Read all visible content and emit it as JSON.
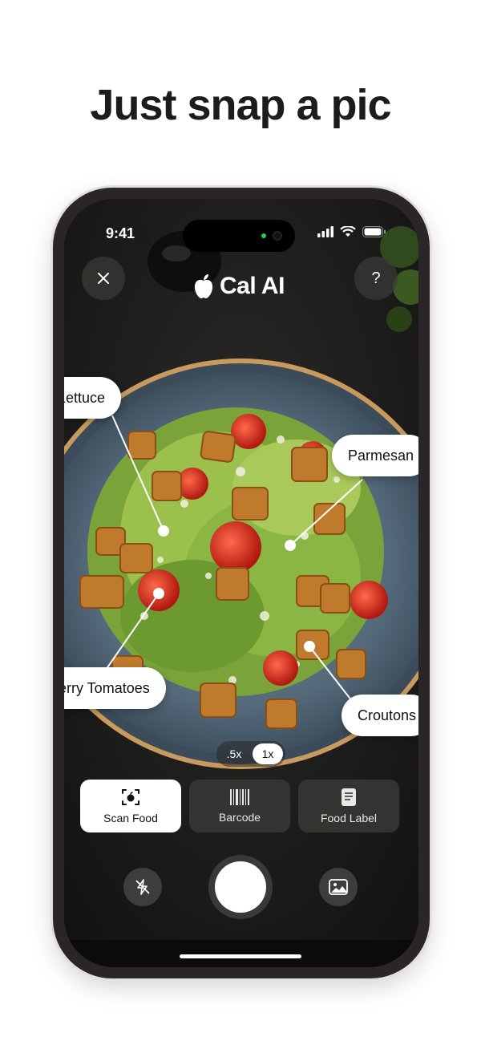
{
  "headline": "Just snap a pic",
  "status_bar": {
    "time": "9:41"
  },
  "header": {
    "brand_name": "Cal AI",
    "close_icon": "close-icon",
    "help_label": "?"
  },
  "callouts": {
    "lettuce": "Lettuce",
    "parmesan": "Parmesan",
    "cherry_tomatoes": "Cherry Tomatoes",
    "croutons": "Croutons"
  },
  "zoom": {
    "options": [
      ".5x",
      "1x"
    ],
    "selected": "1x"
  },
  "modes": [
    {
      "label": "Scan Food",
      "icon": "scan-food-icon",
      "active": true
    },
    {
      "label": "Barcode",
      "icon": "barcode-icon",
      "active": false
    },
    {
      "label": "Food Label",
      "icon": "food-label-icon",
      "active": false
    }
  ],
  "controls": {
    "flash_icon": "flash-off-icon",
    "gallery_icon": "gallery-icon",
    "shutter": "shutter-button"
  },
  "colors": {
    "accent": "#ffffff",
    "screen_bg": "#1d1c1b",
    "plate_blue": "#5a7385",
    "plate_rim": "#c89a5e"
  }
}
